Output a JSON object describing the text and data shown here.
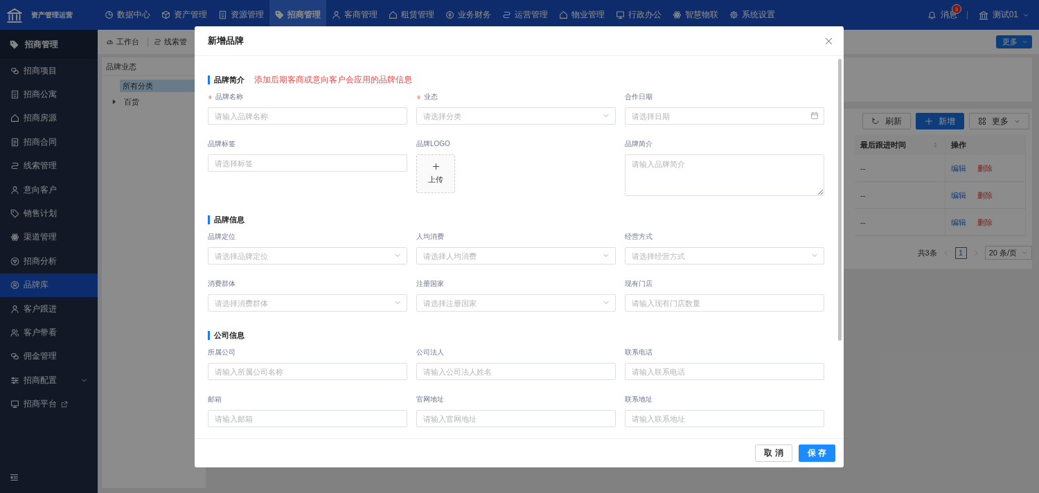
{
  "topbar": {
    "app_title": "资产管理运营",
    "nav": [
      {
        "label": "数据中心",
        "selected": false
      },
      {
        "label": "资产管理",
        "selected": false
      },
      {
        "label": "资源管理",
        "selected": false
      },
      {
        "label": "招商管理",
        "selected": true
      },
      {
        "label": "客商管理",
        "selected": false
      },
      {
        "label": "租赁管理",
        "selected": false
      },
      {
        "label": "业务财务",
        "selected": false
      },
      {
        "label": "运营管理",
        "selected": false
      },
      {
        "label": "物业管理",
        "selected": false
      },
      {
        "label": "行政办公",
        "selected": false
      },
      {
        "label": "智慧物联",
        "selected": false
      },
      {
        "label": "系统设置",
        "selected": false
      }
    ],
    "messages": {
      "label": "消息",
      "badge": "3"
    },
    "user": "测试01"
  },
  "sidebar": {
    "title": "招商管理",
    "items": [
      {
        "label": "招商项目",
        "selected": false,
        "kind": "item"
      },
      {
        "label": "招商公寓",
        "selected": false,
        "kind": "item"
      },
      {
        "label": "招商房源",
        "selected": false,
        "kind": "item"
      },
      {
        "label": "招商合同",
        "selected": false,
        "kind": "item"
      },
      {
        "label": "线索管理",
        "selected": false,
        "kind": "item"
      },
      {
        "label": "意向客户",
        "selected": false,
        "kind": "item"
      },
      {
        "label": "销售计划",
        "selected": false,
        "kind": "item"
      },
      {
        "label": "渠道管理",
        "selected": false,
        "kind": "item"
      },
      {
        "label": "招商分析",
        "selected": false,
        "kind": "item"
      },
      {
        "label": "品牌库",
        "selected": true,
        "kind": "item"
      },
      {
        "label": "客户跟进",
        "selected": false,
        "kind": "item"
      },
      {
        "label": "客户带看",
        "selected": false,
        "kind": "item"
      },
      {
        "label": "佣金管理",
        "selected": false,
        "kind": "item"
      },
      {
        "label": "招商配置",
        "selected": false,
        "kind": "group"
      },
      {
        "label": "招商平台",
        "selected": false,
        "kind": "external"
      }
    ]
  },
  "tabs": [
    "工作台",
    "线索管"
  ],
  "more_button": "更多",
  "category_panel": {
    "title": "品牌业态",
    "tree": [
      {
        "label": "所有分类",
        "selected": true,
        "kind": "leaf"
      },
      {
        "label": "百货",
        "selected": false,
        "expanded": false,
        "kind": "branch"
      }
    ]
  },
  "toolbar": [
    {
      "label": "刷新",
      "kind": "refresh"
    },
    {
      "label": "新增",
      "kind": "add"
    },
    {
      "label": "更多",
      "kind": "more"
    }
  ],
  "table": {
    "columns": [
      {
        "label": "最后跟进时间",
        "sortable": true
      },
      {
        "label": "操作",
        "sortable": false
      }
    ],
    "rows": [
      {
        "last_follow_up": "--",
        "actions": [
          {
            "label": "编辑",
            "kind": "edit"
          },
          {
            "label": "删除",
            "kind": "delete"
          }
        ]
      },
      {
        "last_follow_up": "--",
        "actions": [
          {
            "label": "编辑",
            "kind": "edit"
          },
          {
            "label": "删除",
            "kind": "delete"
          }
        ]
      },
      {
        "last_follow_up": "--",
        "actions": [
          {
            "label": "编辑",
            "kind": "edit"
          },
          {
            "label": "删除",
            "kind": "delete"
          }
        ]
      }
    ]
  },
  "pagination": {
    "total": "共3条",
    "pages": [
      {
        "label": "1",
        "selected": true
      }
    ],
    "page_size": "20 条/页"
  },
  "modal": {
    "title": "新增品牌",
    "sections": [
      {
        "title": "品牌简介",
        "note": "添加后期客商或意向客户会应用的品牌信息",
        "fields": [
          {
            "label": "品牌名称",
            "required": true,
            "kind": "input",
            "placeholder": "请输入品牌名称"
          },
          {
            "label": "业态",
            "required": true,
            "kind": "select",
            "placeholder": "请选择分类"
          },
          {
            "label": "合作日期",
            "required": false,
            "kind": "date",
            "placeholder": "请选择日期"
          },
          {
            "label": "品牌标签",
            "required": false,
            "kind": "input",
            "placeholder": "请选择标签"
          },
          {
            "label": "品牌LOGO",
            "required": false,
            "kind": "upload",
            "button": "上传"
          },
          {
            "label": "品牌简介",
            "required": false,
            "kind": "textarea",
            "placeholder": "请输入品牌简介"
          }
        ]
      },
      {
        "title": "品牌信息",
        "fields": [
          {
            "label": "品牌定位",
            "required": false,
            "kind": "select",
            "placeholder": "请选择品牌定位"
          },
          {
            "label": "人均消费",
            "required": false,
            "kind": "select",
            "placeholder": "请选择人均消费"
          },
          {
            "label": "经营方式",
            "required": false,
            "kind": "select",
            "placeholder": "请选择经营方式"
          },
          {
            "label": "消费群体",
            "required": false,
            "kind": "select",
            "placeholder": "请选择消费群体"
          },
          {
            "label": "注册国家",
            "required": false,
            "kind": "select",
            "placeholder": "请选择注册国家"
          },
          {
            "label": "现有门店",
            "required": false,
            "kind": "input",
            "placeholder": "请输入现有门店数量"
          }
        ]
      },
      {
        "title": "公司信息",
        "fields": [
          {
            "label": "所属公司",
            "required": false,
            "kind": "input",
            "placeholder": "请输入所属公司名称"
          },
          {
            "label": "公司法人",
            "required": false,
            "kind": "input",
            "placeholder": "请输入公司法人姓名"
          },
          {
            "label": "联系电话",
            "required": false,
            "kind": "input",
            "placeholder": "请输入联系电话"
          },
          {
            "label": "邮箱",
            "required": false,
            "kind": "input",
            "placeholder": "请输入邮箱"
          },
          {
            "label": "官网地址",
            "required": false,
            "kind": "input",
            "placeholder": "请输入官网地址"
          },
          {
            "label": "联系地址",
            "required": false,
            "kind": "input",
            "placeholder": "请输入联系地址"
          }
        ]
      }
    ],
    "buttons": [
      {
        "label": "取 消",
        "kind": "default"
      },
      {
        "label": "保 存",
        "kind": "primary"
      }
    ]
  }
}
